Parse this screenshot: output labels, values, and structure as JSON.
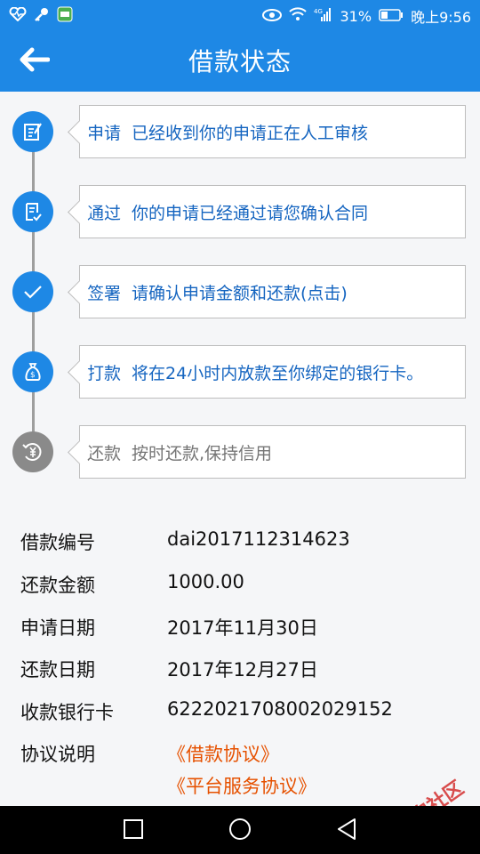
{
  "status_bar": {
    "network": "4G",
    "battery": "31%",
    "time": "晚上9:56"
  },
  "app_bar": {
    "title": "借款状态"
  },
  "steps": [
    {
      "name": "申请",
      "desc": "已经收到你的申请正在人工审核",
      "icon": "edit-document-icon",
      "active": true
    },
    {
      "name": "通过",
      "desc": "你的申请已经通过请您确认合同",
      "icon": "contract-check-icon",
      "active": true
    },
    {
      "name": "签署",
      "desc": "请确认申请金额和还款(点击)",
      "icon": "check-icon",
      "active": true
    },
    {
      "name": "打款",
      "desc": "将在24小时内放款至你绑定的银行卡。",
      "icon": "money-bag-icon",
      "active": true
    },
    {
      "name": "还款",
      "desc": "按时还款,保持信用",
      "icon": "yen-refresh-icon",
      "active": false
    }
  ],
  "details": {
    "loan_no_label": "借款编号",
    "loan_no": "dai2017112314623",
    "amount_label": "还款金额",
    "amount": "1000.00",
    "apply_date_label": "申请日期",
    "apply_date": "2017年11月30日",
    "repay_date_label": "还款日期",
    "repay_date": "2017年12月27日",
    "bank_card_label": "收款银行卡",
    "bank_card": "6222021708002029152",
    "agreement_label": "协议说明",
    "agreement_links": [
      "《借款协议》",
      "《平台服务协议》"
    ]
  },
  "watermark": "卡农社区",
  "colors": {
    "primary": "#1e88e5",
    "step_text": "#1565c0",
    "link": "#e65100",
    "inactive": "#8a8a8a"
  }
}
